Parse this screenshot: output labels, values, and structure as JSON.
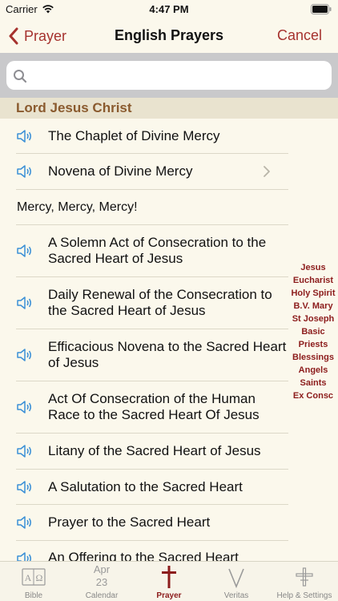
{
  "status": {
    "carrier": "Carrier",
    "time": "4:47 PM"
  },
  "nav": {
    "back_label": "Prayer",
    "title": "English Prayers",
    "cancel_label": "Cancel"
  },
  "search": {
    "placeholder": "",
    "value": ""
  },
  "section": {
    "title": "Lord Jesus Christ"
  },
  "prayers": [
    {
      "title": "The Chaplet of Divine Mercy",
      "audio": true
    },
    {
      "title": "Novena of Divine Mercy",
      "audio": true,
      "chevron": true
    },
    {
      "title": "Mercy, Mercy, Mercy!",
      "audio": false
    },
    {
      "title": "A Solemn Act of Consecration to the Sacred Heart of Jesus",
      "audio": true
    },
    {
      "title": "Daily Renewal of the Consecration to the Sacred Heart of Jesus",
      "audio": true
    },
    {
      "title": "Efficacious Novena to the Sacred Heart of Jesus",
      "audio": true
    },
    {
      "title": "Act Of Consecration of the Human Race to the Sacred Heart Of Jesus",
      "audio": true
    },
    {
      "title": "Litany of the Sacred Heart of Jesus",
      "audio": true
    },
    {
      "title": "A Salutation to the Sacred Heart",
      "audio": true
    },
    {
      "title": "Prayer to the Sacred Heart",
      "audio": true
    },
    {
      "title": "An Offering to the Sacred Heart",
      "audio": true
    }
  ],
  "index": [
    "Jesus",
    "Eucharist",
    "Holy Spirit",
    "B.V. Mary",
    "St Joseph",
    "Basic",
    "Priests",
    "Blessings",
    "Angels",
    "Saints",
    "Ex Consc"
  ],
  "tabs": [
    {
      "label": "Bible",
      "icon": "bible-icon"
    },
    {
      "label": "Calendar",
      "icon": "calendar-icon",
      "month": "Apr",
      "day": "23"
    },
    {
      "label": "Prayer",
      "icon": "cross-icon",
      "active": true
    },
    {
      "label": "Veritas",
      "icon": "veritas-icon"
    },
    {
      "label": "Help & Settings",
      "icon": "settings-icon"
    }
  ],
  "colors": {
    "accent": "#a6322e",
    "index": "#8c1c1c",
    "section": "#8a5a2e",
    "audio": "#3a8fd6"
  }
}
